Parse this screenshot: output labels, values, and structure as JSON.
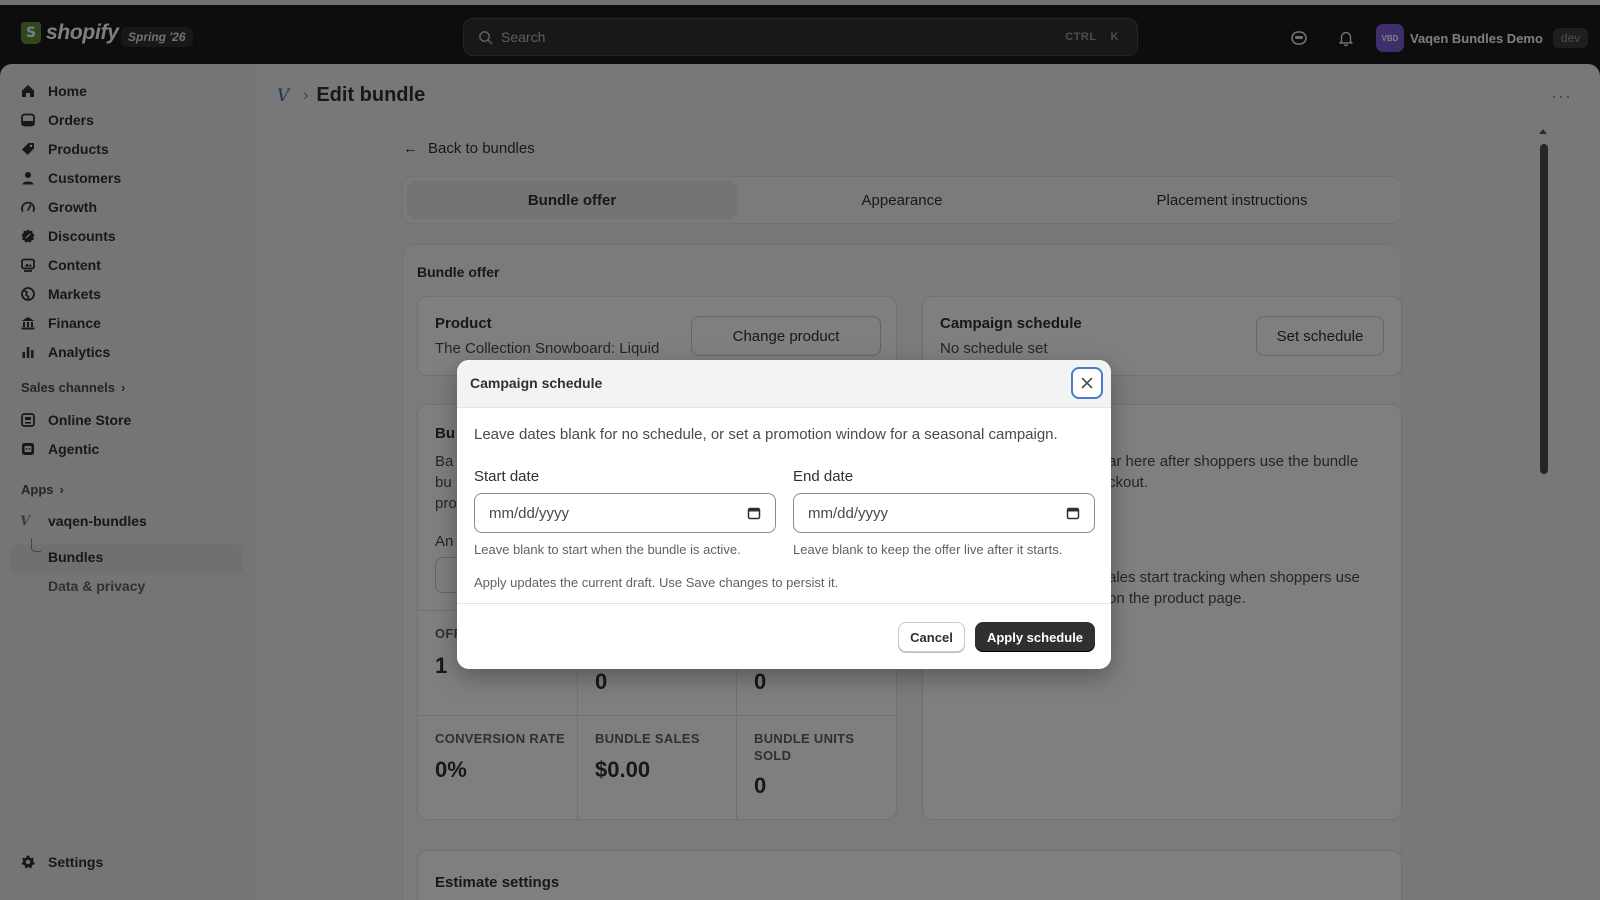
{
  "topbar": {
    "brand": "shopify",
    "edition": "Spring '26",
    "search_placeholder": "Search",
    "shortcut_key1": "CTRL",
    "shortcut_key2": "K",
    "store_initials": "VBD",
    "store_name": "Vaqen Bundles Demo",
    "store_env": "dev"
  },
  "sidebar": {
    "items": [
      {
        "label": "Home",
        "icon": "home-icon"
      },
      {
        "label": "Orders",
        "icon": "orders-icon"
      },
      {
        "label": "Products",
        "icon": "tag-icon"
      },
      {
        "label": "Customers",
        "icon": "person-icon"
      },
      {
        "label": "Growth",
        "icon": "gauge-icon"
      },
      {
        "label": "Discounts",
        "icon": "discount-icon"
      },
      {
        "label": "Content",
        "icon": "content-icon"
      },
      {
        "label": "Markets",
        "icon": "globe-icon"
      },
      {
        "label": "Finance",
        "icon": "bank-icon"
      },
      {
        "label": "Analytics",
        "icon": "bar-chart-icon"
      }
    ],
    "sales_channels_label": "Sales channels",
    "channels": [
      {
        "label": "Online Store",
        "icon": "store-icon"
      },
      {
        "label": "Agentic",
        "icon": "agentic-icon"
      }
    ],
    "apps_label": "Apps",
    "app_name": "vaqen-bundles",
    "app_sub_bundles": "Bundles",
    "app_sub_privacy": "Data & privacy",
    "settings_label": "Settings"
  },
  "page": {
    "breadcrumb_title": "Edit bundle",
    "back_link": "Back to bundles",
    "tabs": [
      "Bundle offer",
      "Appearance",
      "Placement instructions"
    ],
    "section_title": "Bundle offer",
    "product_title": "Product",
    "product_name": "The Collection Snowboard: Liquid",
    "change_product": "Change product",
    "schedule_title": "Campaign schedule",
    "schedule_status": "No schedule set",
    "set_schedule": "Set schedule",
    "partial_left_title": "Bu",
    "partial_left_line1": "Ba",
    "partial_left_line2": "bu",
    "partial_left_line3": "pro",
    "partial_left_line4": "An",
    "partial_right_line1": "ar here after shoppers use the bundle",
    "partial_right_line2": "ckout.",
    "partial_right_line3": "ales start tracking when shoppers use",
    "partial_right_line4": "on the product page.",
    "stat_offers_label": "OFF",
    "stat_offers_value": "1",
    "stat_mid1_value": "0",
    "stat_mid2_value": "0",
    "stat_conv_label": "CONVERSION RATE",
    "stat_conv_value": "0%",
    "stat_sales_label": "BUNDLE SALES",
    "stat_sales_value": "$0.00",
    "stat_units_label_1": "BUNDLE UNITS",
    "stat_units_label_2": "SOLD",
    "stat_units_value": "0",
    "estimate_title": "Estimate settings"
  },
  "modal": {
    "title": "Campaign schedule",
    "description": "Leave dates blank for no schedule, or set a promotion window for a seasonal campaign.",
    "start_label": "Start date",
    "start_placeholder": "mm/dd/yyyy",
    "start_help": "Leave blank to start when the bundle is active.",
    "end_label": "End date",
    "end_placeholder": "mm/dd/yyyy",
    "end_help": "Leave blank to keep the offer live after it starts.",
    "note": "Apply updates the current draft. Use Save changes to persist it.",
    "cancel": "Cancel",
    "apply": "Apply schedule"
  },
  "colors": {
    "topbar_bg": "#1a1a1a",
    "primary_button": "#303030",
    "focus_ring": "#4c7cc8",
    "store_avatar": "#7c5cd6"
  }
}
